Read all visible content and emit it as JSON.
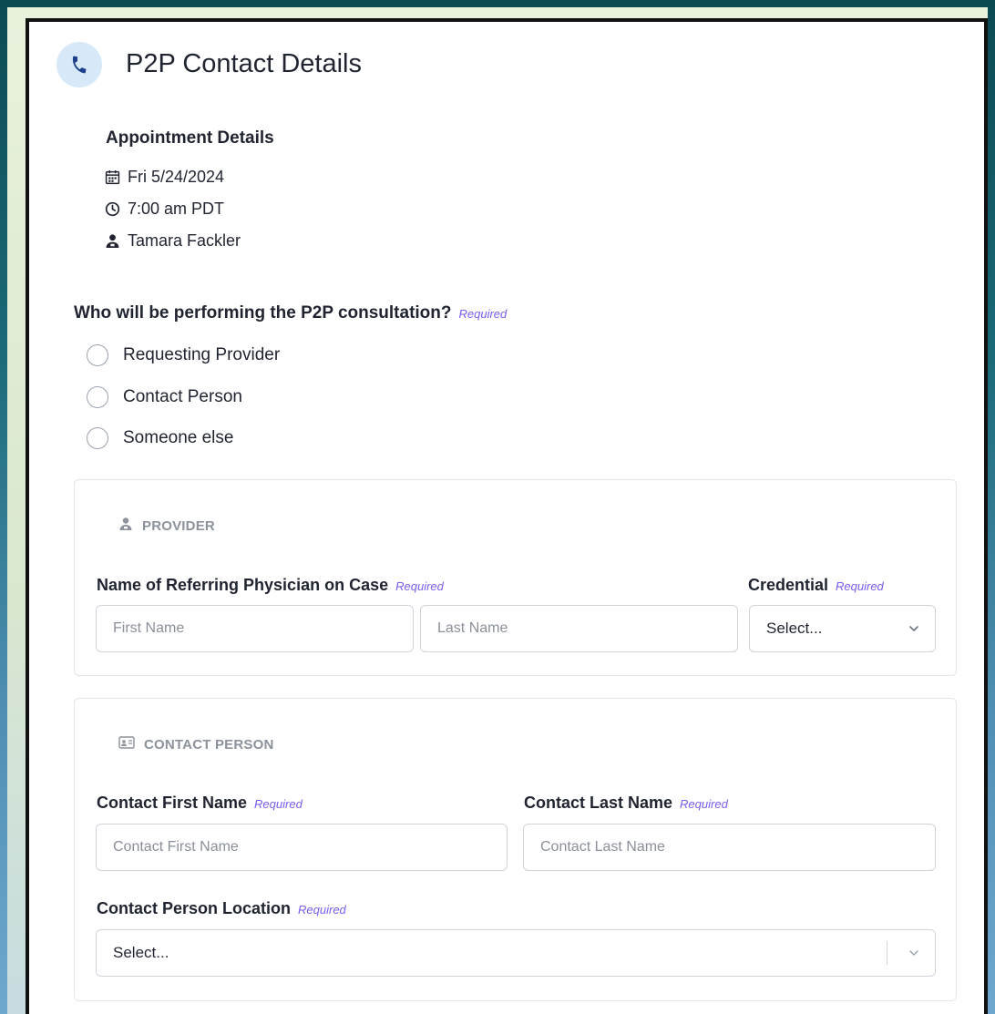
{
  "header": {
    "title": "P2P Contact Details",
    "icon": "phone-icon"
  },
  "appointment": {
    "title": "Appointment Details",
    "date": "Fri 5/24/2024",
    "time": "7:00 am PDT",
    "person": "Tamara Fackler"
  },
  "question": {
    "label": "Who will be performing the P2P consultation?",
    "required": "Required",
    "options": [
      "Requesting Provider",
      "Contact Person",
      "Someone else"
    ]
  },
  "provider": {
    "heading": "PROVIDER",
    "name_label": "Name of Referring Physician on Case",
    "name_required": "Required",
    "first_placeholder": "First Name",
    "last_placeholder": "Last Name",
    "credential_label": "Credential",
    "credential_required": "Required",
    "credential_value": "Select..."
  },
  "contact": {
    "heading": "CONTACT PERSON",
    "first_label": "Contact First Name",
    "first_required": "Required",
    "first_placeholder": "Contact First Name",
    "last_label": "Contact Last Name",
    "last_required": "Required",
    "last_placeholder": "Contact Last Name",
    "location_label": "Contact Person Location",
    "location_required": "Required",
    "location_value": "Select..."
  },
  "colors": {
    "accent": "#7a5cf0",
    "icon_bg": "#d7e9f8",
    "icon_fg": "#1e3f8a"
  }
}
